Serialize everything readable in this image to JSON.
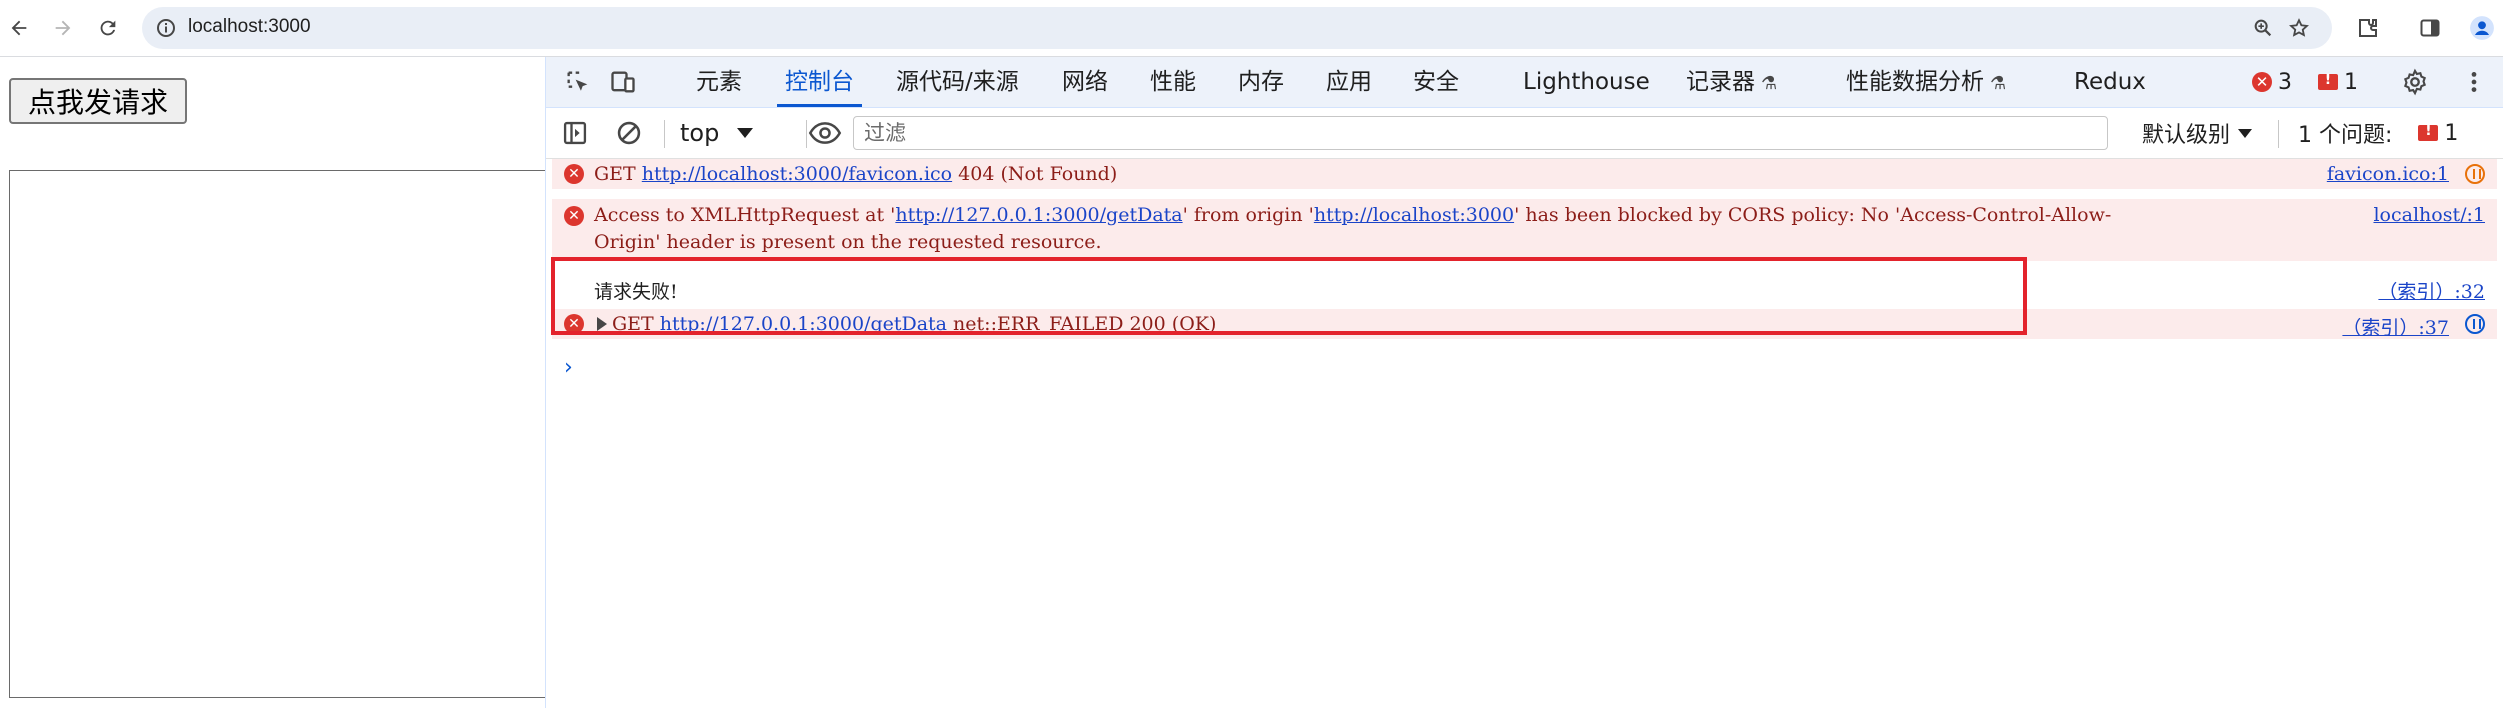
{
  "browser": {
    "url": "localhost:3000"
  },
  "page": {
    "button_label": "点我发请求",
    "result_text": ""
  },
  "devtools": {
    "tabs": [
      {
        "label": "元素"
      },
      {
        "label": "控制台"
      },
      {
        "label": "源代码/来源"
      },
      {
        "label": "网络"
      },
      {
        "label": "性能"
      },
      {
        "label": "内存"
      },
      {
        "label": "应用"
      },
      {
        "label": "安全"
      },
      {
        "label": "Lighthouse"
      },
      {
        "label": "记录器"
      },
      {
        "label": "性能数据分析"
      },
      {
        "label": "Redux"
      }
    ],
    "active_tab": "控制台",
    "error_count": "3",
    "issue_count": "1",
    "toolbar": {
      "context": "top",
      "filter_placeholder": "过滤",
      "levels": "默认级别",
      "issues_label": "1 个问题:",
      "issues_count": "1"
    },
    "console": {
      "messages": [
        {
          "type": "error",
          "prefix": "GET ",
          "link": "http://localhost:3000/favicon.ico",
          "suffix": " 404 (Not Found)",
          "source": "favicon.ico:1"
        },
        {
          "type": "error",
          "line1_a": "Access to XMLHttpRequest at '",
          "line1_link1": "http://127.0.0.1:3000/getData",
          "line1_b": "' from origin '",
          "line1_link2": "http://localhost:3000",
          "line1_c": "' has been blocked by CORS policy: No 'Access-Control-Allow-",
          "line2": "Origin' header is present on the requested resource.",
          "source": "localhost/:1"
        },
        {
          "type": "log",
          "text": "请求失败!",
          "source": "（索引）:32"
        },
        {
          "type": "error",
          "prefix": "GET ",
          "link": "http://127.0.0.1:3000/getData",
          "suffix": " net::ERR_FAILED 200 (OK)",
          "source": "（索引）:37"
        }
      ]
    }
  },
  "colors": {
    "accent": "#0b57d0",
    "error": "#dc362e",
    "error_bg": "#fcebeb",
    "highlight": "#e3232c"
  }
}
